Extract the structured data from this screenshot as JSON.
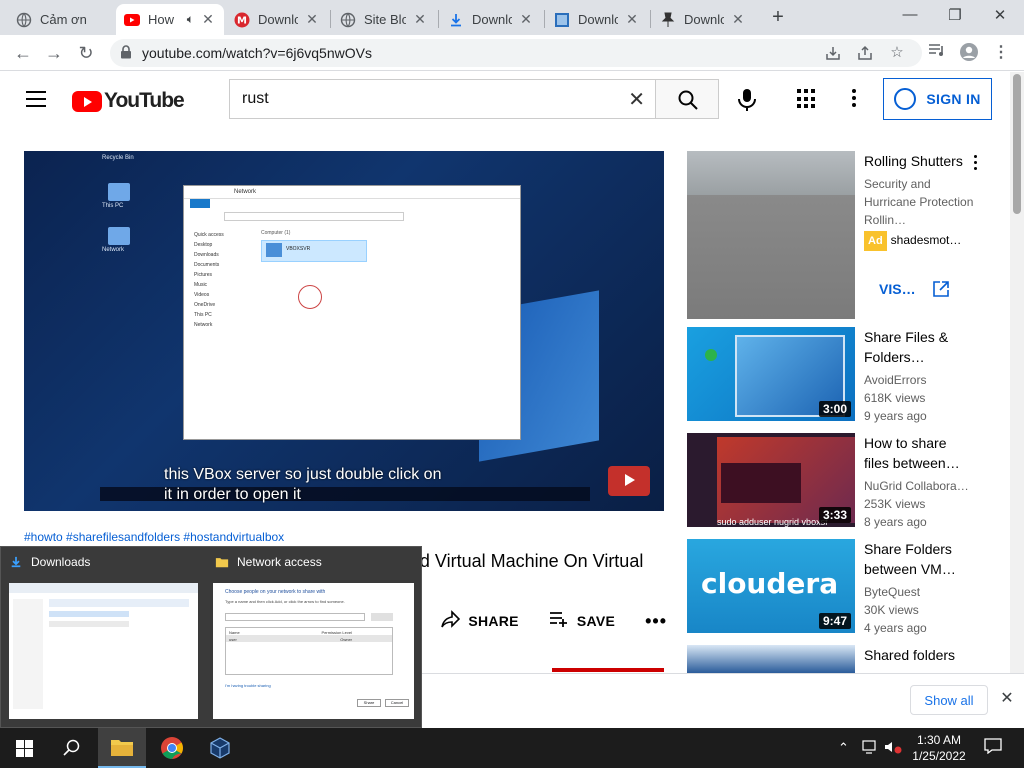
{
  "browser": {
    "tabs": [
      {
        "title": "Cảm ơn",
        "icon": "globe-icon"
      },
      {
        "title": "How",
        "icon": "youtube-icon",
        "active": true,
        "audio": true
      },
      {
        "title": "Downlo",
        "icon": "mega-icon"
      },
      {
        "title": "Site Blo",
        "icon": "globe-icon"
      },
      {
        "title": "Downlo",
        "icon": "download-icon"
      },
      {
        "title": "Downlo",
        "icon": "bing-icon"
      },
      {
        "title": "Downlo",
        "icon": "pin-icon"
      }
    ],
    "url": "youtube.com/watch?v=6j6vq5nwOVs"
  },
  "youtube": {
    "logo_text": "YouTube",
    "search_value": "rust",
    "signin_label": "SIGN IN"
  },
  "video": {
    "caption_line1": "this VBox server so just double click on",
    "caption_line2": "it in order to open it",
    "hashtags": "#howto #sharefilesandfolders #hostandvirtualbox",
    "title": "How To Share Files and Folders between Host and Virtual Machine On Virtual Box (Windows) ?",
    "actions": [
      {
        "label": "",
        "icon": "dislike-icon"
      },
      {
        "label": "SHARE",
        "icon": "share-icon"
      },
      {
        "label": "SAVE",
        "icon": "save-playlist-icon"
      }
    ],
    "inner_explorer": {
      "window_title": "Network",
      "nav_items": [
        "Quick access",
        "Desktop",
        "Downloads",
        "Documents",
        "Pictures",
        "Music",
        "Videos",
        "OneDrive",
        "This PC",
        "Network"
      ],
      "section": "Computer (1)",
      "selected_item": "VBOXSVR",
      "desktop_icons": [
        "Recycle Bin",
        "This PC",
        "Network"
      ]
    }
  },
  "sidebar": {
    "ad": {
      "title": "Rolling Shutters",
      "desc": "Security and Hurricane Protection Rollin…",
      "badge": "Ad",
      "advertiser": "shadesmot…",
      "visit_label": "VIS…"
    },
    "items": [
      {
        "title": "Share Files & Folders…",
        "channel": "AvoidErrors",
        "views": "618K views",
        "age": "9 years ago",
        "duration": "3:00"
      },
      {
        "title": "How to share files between…",
        "channel": "NuGrid Collabora…",
        "views": "253K views",
        "age": "8 years ago",
        "duration": "3:33"
      },
      {
        "title": "Share Folders between VM…",
        "channel": "ByteQuest",
        "views": "30K views",
        "age": "4 years ago",
        "duration": "9:47"
      },
      {
        "title": "Shared folders",
        "channel": "",
        "views": "",
        "age": "",
        "duration": ""
      }
    ],
    "thumb_texts": {
      "item2": "sudo adduser nugrid vboxsf",
      "item3": "cloudera"
    }
  },
  "downloads_bar": {
    "show_all": "Show all"
  },
  "taskbar_preview": {
    "windows": [
      {
        "title": "Downloads",
        "icon": "downloads-folder-icon"
      },
      {
        "title": "Network access",
        "icon": "network-folder-icon"
      }
    ],
    "network_dialog": {
      "prompt": "Choose people on your network to share with",
      "hint": "Type a name and then click Add, or click the arrow to find someone.",
      "col_name": "Name",
      "col_perm": "Permission Level",
      "row_name": "user",
      "row_perm": "Owner",
      "link": "I'm having trouble sharing",
      "share_btn": "Share",
      "cancel_btn": "Cancel"
    }
  },
  "system": {
    "time": "1:30 AM",
    "date": "1/25/2022"
  },
  "colors": {
    "youtube_red": "#ff0000",
    "link_blue": "#065fd4",
    "taskbar": "#1c1c1c",
    "tabstrip": "#dee1e6"
  }
}
